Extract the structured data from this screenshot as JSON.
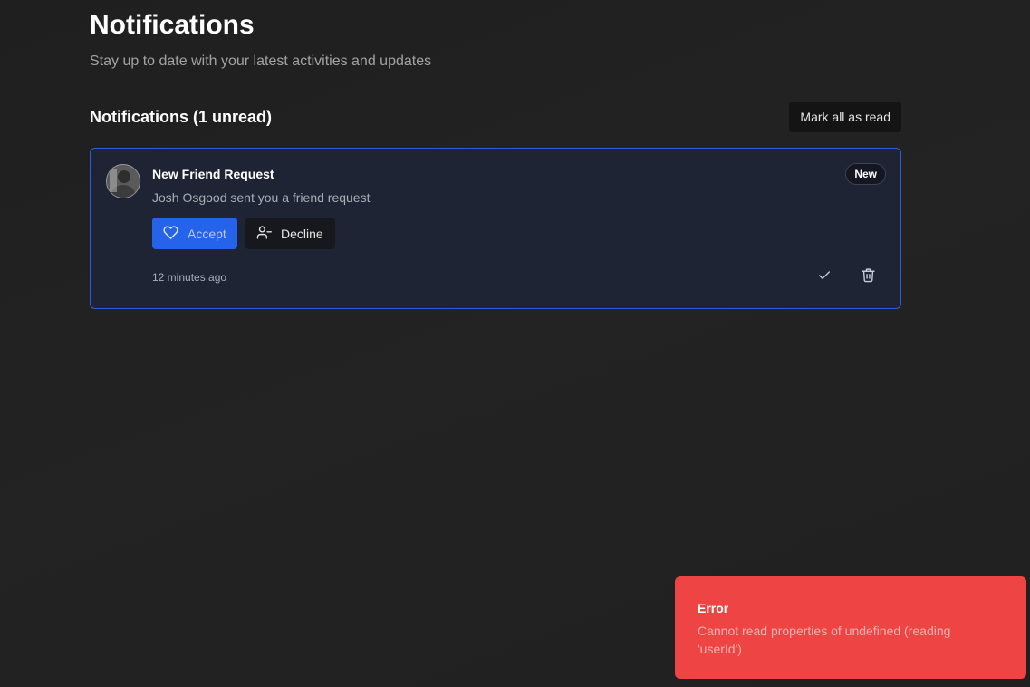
{
  "header": {
    "title": "Notifications",
    "subtitle": "Stay up to date with your latest activities and updates"
  },
  "section": {
    "title": "Notifications (1 unread)",
    "mark_all_label": "Mark all as read"
  },
  "notification": {
    "title": "New Friend Request",
    "message": "Josh Osgood sent you a friend request",
    "badge": "New",
    "accept_label": "Accept",
    "decline_label": "Decline",
    "timestamp": "12 minutes ago",
    "icons": {
      "accept": "heart-icon",
      "decline": "user-minus-icon",
      "mark_read": "check-icon",
      "delete": "trash-icon"
    }
  },
  "toast": {
    "title": "Error",
    "message": "Cannot read properties of undefined (reading 'userId')"
  },
  "colors": {
    "background": "#222222",
    "card_background": "#1f2434",
    "card_border": "#2b5fd9",
    "accent": "#2563eb",
    "error": "#ef4444"
  }
}
